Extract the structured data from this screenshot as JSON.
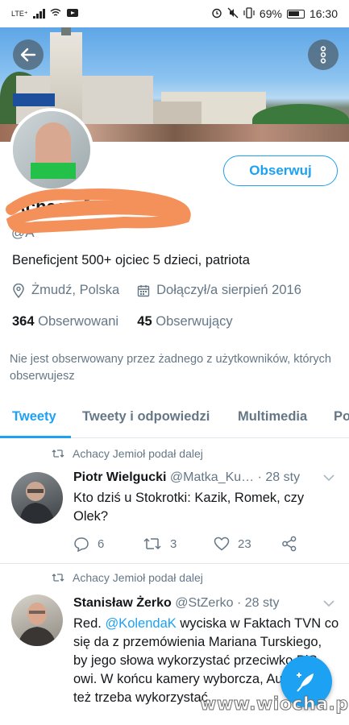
{
  "status_bar": {
    "carrier": "LTE⁺",
    "battery": "69%",
    "time": "16:30"
  },
  "profile": {
    "name": "Achacy Jemioł",
    "handle": "@A",
    "follow_label": "Obserwuj",
    "bio": "Beneficjent 500+ ojciec 5 dzieci, patriota",
    "location": "Żmudź, Polska",
    "joined": "Dołączył/a sierpień 2016",
    "following_count": "364",
    "following_label": "Obserwowani",
    "followers_count": "45",
    "followers_label": "Obserwujący",
    "not_followed_note": "Nie jest obserwowany przez żadnego z użytkowników, których obserwujesz"
  },
  "tabs": [
    {
      "label": "Tweety",
      "active": true
    },
    {
      "label": "Tweety i odpowiedzi",
      "active": false
    },
    {
      "label": "Multimedia",
      "active": false
    },
    {
      "label": "Po",
      "active": false
    }
  ],
  "tweets": [
    {
      "retweeted_by": "Achacy Jemioł podał dalej",
      "author": "Piotr Wielgucki",
      "handle": "@Matka_Ku…",
      "date": "· 28 sty",
      "text": "Kto dziś u Stokrotki: Kazik, Romek, czy Olek?",
      "replies": "6",
      "retweets": "3",
      "likes": "23"
    },
    {
      "retweeted_by": "Achacy Jemioł podał dalej",
      "author": "Stanisław Żerko",
      "handle": "@StZerko",
      "date": "· 28 sty",
      "text_before": "Red. ",
      "mention": "@KolendaK",
      "text_after": " wyciska w Faktach TVN co się da z przemówienia Mariana Turskiego, by jego słowa wykorzystać przeciwko PiS-owi. W końcu kamery wyborcza, Auschwitz też trzeba wykorzystać."
    }
  ],
  "watermark": "www.wiocha.pl",
  "colors": {
    "accent": "#1da1f2",
    "secondary_text": "#657786",
    "scribble": "#f4915a"
  }
}
